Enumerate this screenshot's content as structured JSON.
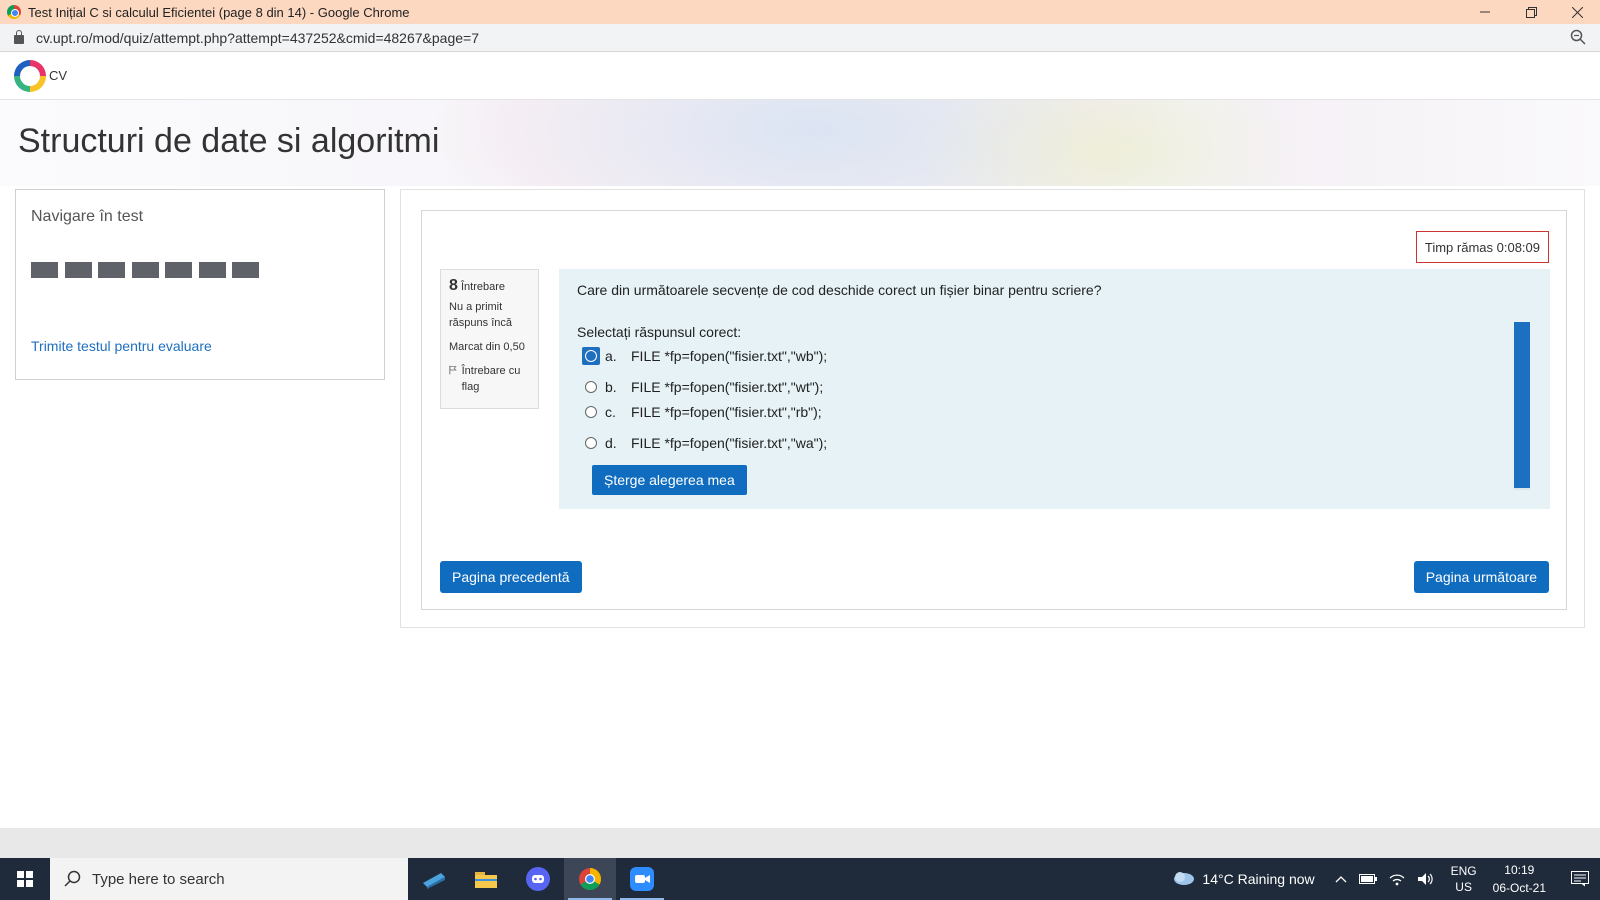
{
  "window": {
    "title": "Test Inițial C si calculul Eficientei (page 8 din 14) - Google Chrome",
    "controls": [
      "minimize",
      "restore",
      "close"
    ]
  },
  "address_bar": {
    "url": "cv.upt.ro/mod/quiz/attempt.php?attempt=437252&cmid=48267&page=7"
  },
  "site": {
    "name": "CV"
  },
  "banner": {
    "title": "Structuri de date si algoritmi"
  },
  "quiz_nav": {
    "title": "Navigare în test",
    "answered_count": 7,
    "total_questions": 14,
    "finish_link": "Trimite testul pentru evaluare"
  },
  "timer": {
    "text": "Timp rămas 0:08:09"
  },
  "question": {
    "number": "8",
    "number_label": "Întrebare",
    "state": "Nu a primit răspuns încă",
    "grade": "Marcat din 0,50",
    "flag": "Întrebare cu flag",
    "text": "Care din următoarele secvențe de cod deschide corect un fișier binar pentru scriere?",
    "prompt": "Selectați răspunsul corect:",
    "answers": [
      {
        "letter": "a.",
        "text": "FILE *fp=fopen(\"fisier.txt\",\"wb\");"
      },
      {
        "letter": "b.",
        "text": "FILE *fp=fopen(\"fisier.txt\",\"wt\");"
      },
      {
        "letter": "c.",
        "text": "FILE *fp=fopen(\"fisier.txt\",\"rb\");"
      },
      {
        "letter": "d.",
        "text": "FILE *fp=fopen(\"fisier.txt\",\"wa\");"
      }
    ],
    "clear_label": "Șterge alegerea mea"
  },
  "navigation": {
    "prev_label": "Pagina precedentă",
    "next_label": "Pagina următoare"
  },
  "taskbar": {
    "search_placeholder": "Type here to search",
    "weather": "14°C  Raining now",
    "lang_top": "ENG",
    "lang_bottom": "US",
    "time": "10:19",
    "date": "06-Oct-21"
  }
}
